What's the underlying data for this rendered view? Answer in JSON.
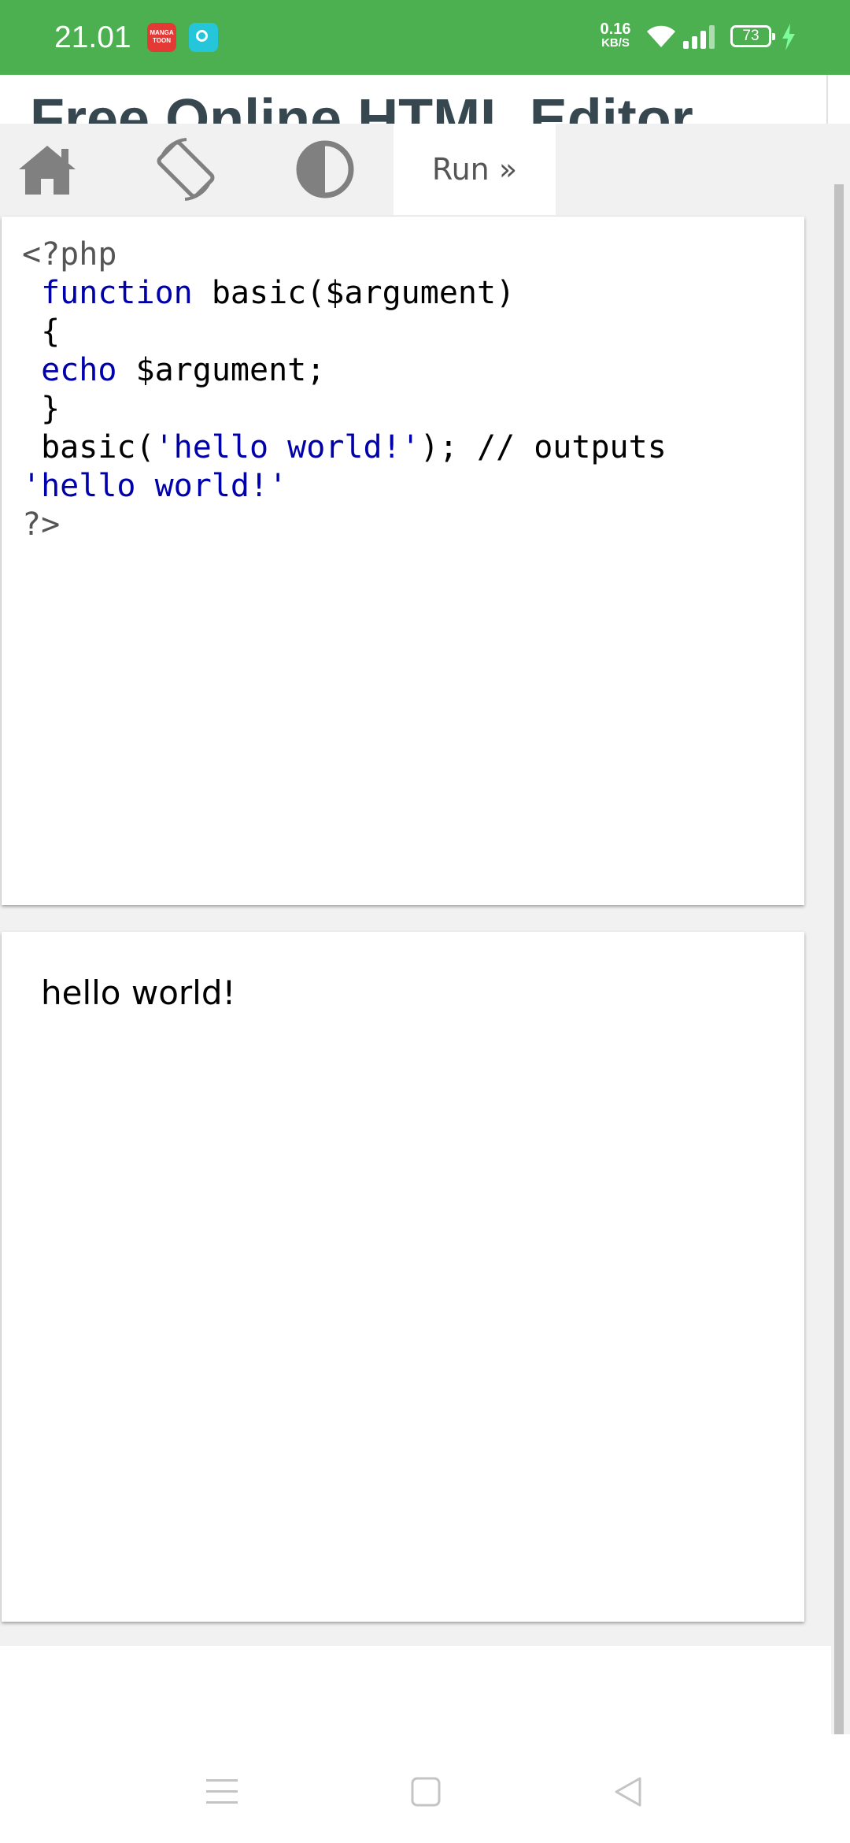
{
  "status_bar": {
    "time": "21.01",
    "notifications": [
      {
        "name": "manga-toon",
        "label": "MANGA TOON"
      },
      {
        "name": "chat"
      }
    ],
    "net_speed": {
      "value": "0.16",
      "unit": "KB/S"
    },
    "battery_level": "73",
    "bar_color": "#4CAF50"
  },
  "page": {
    "title": "Free Online HTML Editor",
    "title_color": "#37474F"
  },
  "toolbar": {
    "home_icon": "home-icon",
    "rotate_icon": "rotate-screen-icon",
    "theme_icon": "contrast-icon",
    "run_label": "Run »"
  },
  "editor": {
    "lines": [
      [
        {
          "t": "<?php",
          "c": "#555555"
        }
      ],
      [
        {
          "t": " ",
          "c": "#000000"
        },
        {
          "t": "function",
          "c": "#0000AA"
        },
        {
          "t": " basic($argument)",
          "c": "#000000"
        }
      ],
      [
        {
          "t": " {",
          "c": "#000000"
        }
      ],
      [
        {
          "t": " ",
          "c": "#000000"
        },
        {
          "t": "echo",
          "c": "#0000AA"
        },
        {
          "t": " $argument;",
          "c": "#000000"
        }
      ],
      [
        {
          "t": " }",
          "c": "#000000"
        }
      ],
      [
        {
          "t": " basic(",
          "c": "#000000"
        },
        {
          "t": "'hello world!'",
          "c": "#0000AA"
        },
        {
          "t": "); // outputs",
          "c": "#000000"
        }
      ],
      [
        {
          "t": "'hello world!'",
          "c": "#0000AA"
        }
      ],
      [
        {
          "t": "?>",
          "c": "#555555"
        }
      ]
    ]
  },
  "output": {
    "text": "hello world!"
  },
  "nav_bar": {
    "menu_icon": "menu-icon",
    "home_icon": "square-home-icon",
    "back_icon": "back-triangle-icon"
  }
}
